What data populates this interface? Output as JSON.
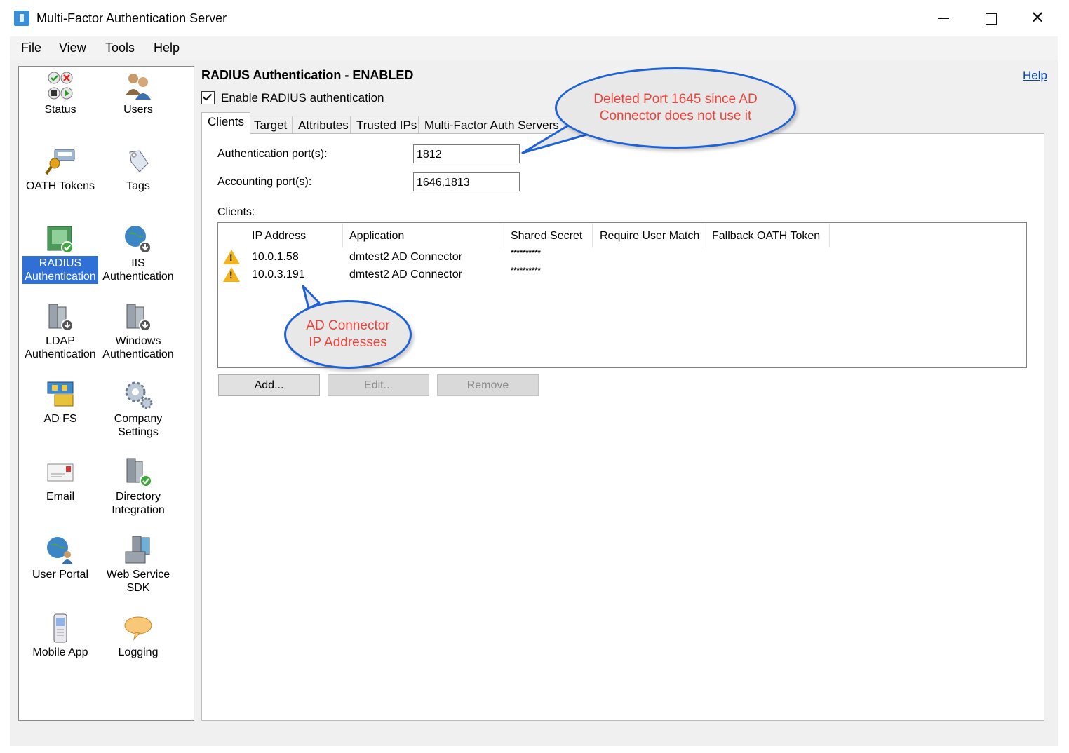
{
  "window": {
    "title": "Multi-Factor Authentication Server",
    "minimize": "—",
    "maximize": "☐",
    "close": "✕"
  },
  "menu": [
    "File",
    "View",
    "Tools",
    "Help"
  ],
  "nav": [
    {
      "label": "Status",
      "icon": "status-icon"
    },
    {
      "label": "Users",
      "icon": "users-icon"
    },
    {
      "label": "OATH Tokens",
      "icon": "oath-token-icon"
    },
    {
      "label": "Tags",
      "icon": "tags-icon"
    },
    {
      "label": "RADIUS Authentication",
      "icon": "radius-icon",
      "selected": true
    },
    {
      "label": "IIS Authentication",
      "icon": "iis-icon"
    },
    {
      "label": "LDAP Authentication",
      "icon": "ldap-server-icon"
    },
    {
      "label": "Windows Authentication",
      "icon": "windows-server-icon"
    },
    {
      "label": "AD FS",
      "icon": "adfs-icon"
    },
    {
      "label": "Company Settings",
      "icon": "gears-icon"
    },
    {
      "label": "Email",
      "icon": "envelope-icon"
    },
    {
      "label": "Directory Integration",
      "icon": "directory-server-icon"
    },
    {
      "label": "User Portal",
      "icon": "globe-user-icon"
    },
    {
      "label": "Web Service SDK",
      "icon": "sdk-server-icon"
    },
    {
      "label": "Mobile App",
      "icon": "mobile-phone-icon"
    },
    {
      "label": "Logging",
      "icon": "speech-bubble-icon"
    }
  ],
  "panel": {
    "title": "RADIUS Authentication - ENABLED",
    "help": "Help",
    "enable_label": "Enable RADIUS authentication",
    "enable_checked": true
  },
  "tabs": [
    "Clients",
    "Target",
    "Attributes",
    "Trusted IPs",
    "Multi-Factor Auth Servers"
  ],
  "active_tab": "Clients",
  "fields": {
    "auth_port_label": "Authentication port(s):",
    "auth_port_value": "1812",
    "acct_port_label": "Accounting port(s):",
    "acct_port_value": "1646,1813",
    "clients_label": "Clients:"
  },
  "clients_table": {
    "headers": [
      "IP Address",
      "Application",
      "Shared Secret",
      "Require User Match",
      "Fallback OATH Token"
    ],
    "rows": [
      {
        "ip": "10.0.1.58",
        "application": "dmtest2 AD Connector",
        "secret": "**********",
        "icon": "warning-icon"
      },
      {
        "ip": "10.0.3.191",
        "application": "dmtest2 AD Connector",
        "secret": "**********",
        "icon": "warning-icon"
      }
    ]
  },
  "buttons": {
    "add": "Add...",
    "edit": "Edit...",
    "remove": "Remove"
  },
  "callouts": {
    "port": "Deleted Port 1645 since AD Connector does not use it",
    "ip": "AD Connector IP Addresses"
  },
  "colors": {
    "callout_border": "#1f62d6",
    "callout_text": "#e8453c",
    "selected_nav": "#2f6fd6",
    "link": "#0645ad"
  }
}
